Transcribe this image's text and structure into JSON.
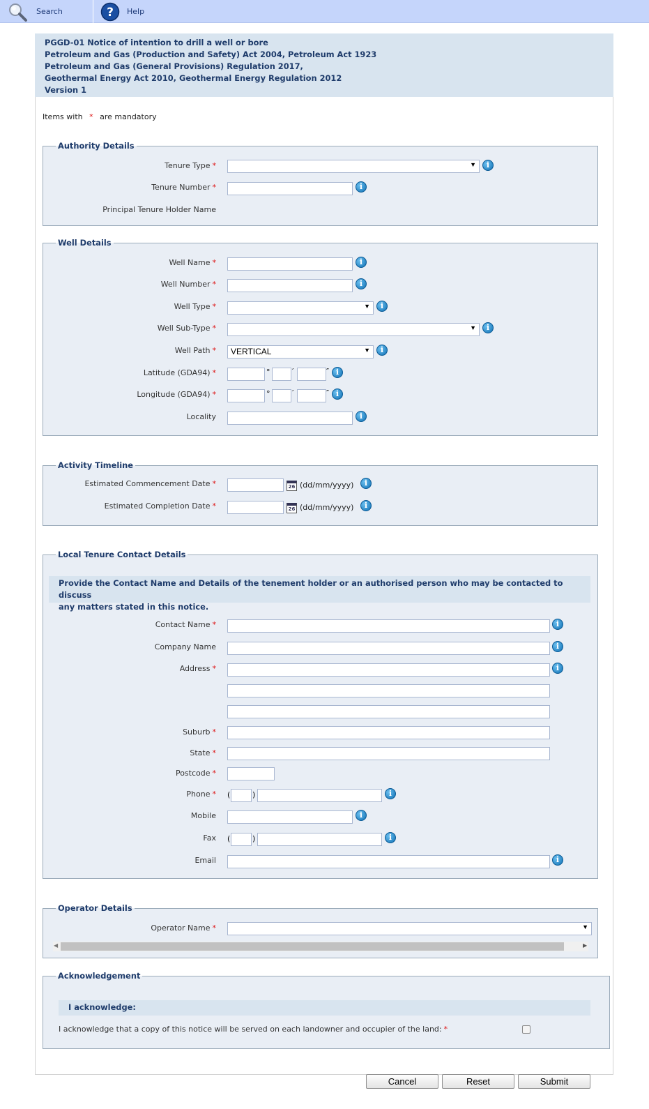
{
  "toolbar": {
    "search_label": "Search",
    "help_label": "Help"
  },
  "header": {
    "lines": [
      "PGGD-01 Notice of intention to drill a well or bore",
      "Petroleum and Gas (Production and Safety) Act 2004, Petroleum Act 1923",
      "Petroleum and Gas (General Provisions) Regulation 2017,",
      "Geothermal Energy Act 2010, Geothermal Energy Regulation 2012",
      "Version 1"
    ]
  },
  "mandatory_note": {
    "prefix": "Items with",
    "star": "*",
    "suffix": "are mandatory"
  },
  "authority": {
    "legend": "Authority Details",
    "tenure_type_label": "Tenure Type",
    "tenure_number_label": "Tenure Number",
    "principal_holder_label": "Principal Tenure Holder Name"
  },
  "well": {
    "legend": "Well Details",
    "name_label": "Well Name",
    "number_label": "Well Number",
    "type_label": "Well Type",
    "subtype_label": "Well Sub-Type",
    "path_label": "Well Path",
    "path_value": "VERTICAL",
    "latitude_label": "Latitude (GDA94)",
    "longitude_label": "Longitude (GDA94)",
    "locality_label": "Locality",
    "deg_symbol": "°",
    "min_symbol": "′",
    "sec_symbol": "″"
  },
  "timeline": {
    "legend": "Activity Timeline",
    "commencement_label": "Estimated Commencement Date",
    "completion_label": "Estimated Completion Date",
    "date_format": "(dd/mm/yyyy)",
    "calendar_day": "26"
  },
  "contact": {
    "legend": "Local Tenure Contact Details",
    "info_line1": "Provide the Contact Name and Details of the tenement holder or an authorised person who may be contacted to discuss",
    "info_line2": "any matters stated in this notice.",
    "contact_name_label": "Contact Name",
    "company_name_label": "Company Name",
    "address_label": "Address",
    "suburb_label": "Suburb",
    "state_label": "State",
    "postcode_label": "Postcode",
    "phone_label": "Phone",
    "mobile_label": "Mobile",
    "fax_label": "Fax",
    "email_label": "Email",
    "paren_open": "(",
    "paren_close": ")"
  },
  "operator": {
    "legend": "Operator Details",
    "name_label": "Operator Name"
  },
  "ack": {
    "legend": "Acknowledgement",
    "heading": "I acknowledge:",
    "statement": "I acknowledge that a copy of this notice will be served on each landowner and occupier of the land:"
  },
  "buttons": {
    "cancel": "Cancel",
    "reset": "Reset",
    "submit": "Submit"
  },
  "icons": {
    "info": "info-icon",
    "calendar": "calendar-icon",
    "search": "search-icon",
    "help": "help-icon",
    "dropdown": "chevron-down-icon"
  },
  "colors": {
    "toolbar_bg": "#c5d5fb",
    "header_bg": "#d8e4ef",
    "section_bg": "#e9eef5",
    "heading_text": "#1f3c6b",
    "required": "#dd1111"
  }
}
